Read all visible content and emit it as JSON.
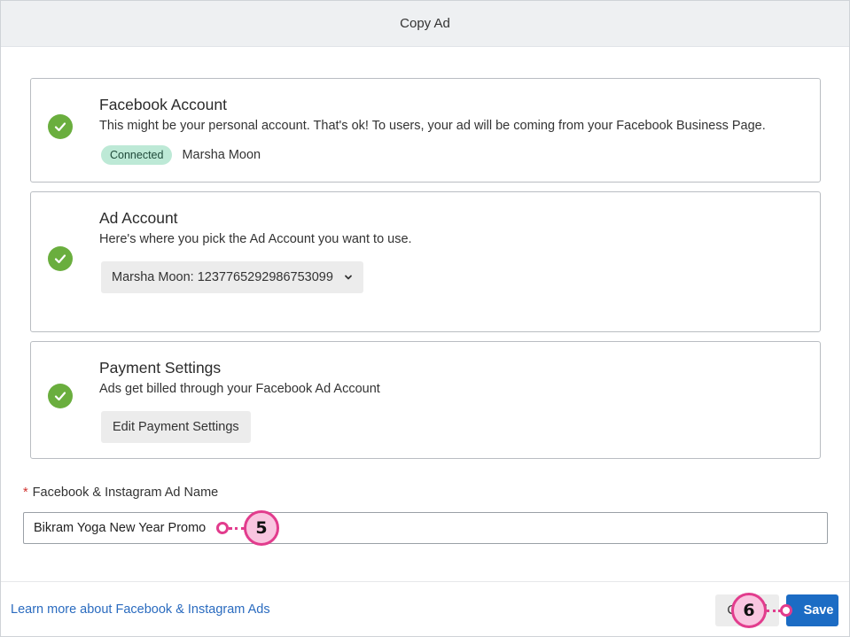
{
  "modal": {
    "title": "Copy Ad"
  },
  "cards": {
    "facebook_account": {
      "title": "Facebook Account",
      "description": "This might be your personal account. That's ok! To users, your ad will be coming from your Facebook Business Page.",
      "status_badge": "Connected",
      "account_name": "Marsha Moon",
      "status_icon": "check-circle-icon"
    },
    "ad_account": {
      "title": "Ad Account",
      "description": "Here's where you pick the Ad Account you want to use.",
      "selected_value": "Marsha Moon: 1237765292986753099",
      "status_icon": "check-circle-icon"
    },
    "payment_settings": {
      "title": "Payment Settings",
      "description": "Ads get billed through your Facebook Ad Account",
      "button_label": "Edit Payment Settings",
      "status_icon": "check-circle-icon"
    }
  },
  "ad_name_field": {
    "required_mark": "*",
    "label": "Facebook & Instagram Ad Name",
    "value": "Bikram Yoga New Year Promo"
  },
  "footer": {
    "learn_more_link": "Learn more about Facebook & Instagram Ads",
    "cancel_label": "Cancel",
    "save_label": "Save"
  },
  "callouts": {
    "step_5": "5",
    "step_6": "6"
  },
  "colors": {
    "check_green": "#6aae3e",
    "badge_bg": "#bde9d6",
    "save_blue": "#1c6cc4",
    "link_blue": "#2a6bbf",
    "callout_pink": "#e23c8d",
    "callout_fill": "#f9c6e0",
    "required_red": "#d0312d"
  }
}
